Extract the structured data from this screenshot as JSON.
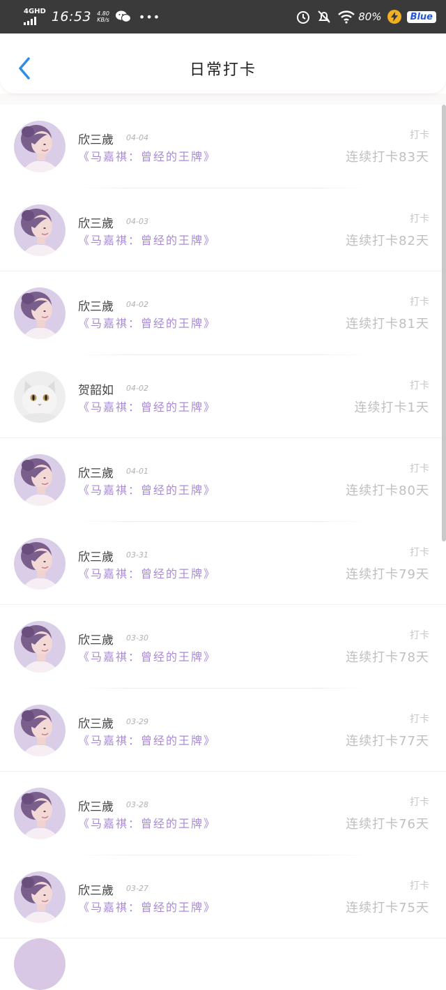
{
  "status_bar": {
    "network": "4GHD",
    "time": "16:53",
    "speed_value": "4.80",
    "speed_unit": "KB/s",
    "battery": "80%",
    "brand": "Blue"
  },
  "header": {
    "title": "日常打卡"
  },
  "colors": {
    "accent_blue": "#2f8de4",
    "content_purple": "#a98ad8",
    "muted_gray": "#bfbfbf"
  },
  "checkins": [
    {
      "user": "欣三歲",
      "date": "04-04",
      "content": "《马嘉祺：曾经的王牌》",
      "tag": "打卡",
      "streak": "连续打卡83天",
      "avatar": "girl-photo"
    },
    {
      "user": "欣三歲",
      "date": "04-03",
      "content": "《马嘉祺：曾经的王牌》",
      "tag": "打卡",
      "streak": "连续打卡82天",
      "avatar": "girl-photo"
    },
    {
      "user": "欣三歲",
      "date": "04-02",
      "content": "《马嘉祺：曾经的王牌》",
      "tag": "打卡",
      "streak": "连续打卡81天",
      "avatar": "girl-photo"
    },
    {
      "user": "贺韶如",
      "date": "04-02",
      "content": "《马嘉祺：曾经的王牌》",
      "tag": "打卡",
      "streak": "连续打卡1天",
      "avatar": "cat-photo"
    },
    {
      "user": "欣三歲",
      "date": "04-01",
      "content": "《马嘉祺：曾经的王牌》",
      "tag": "打卡",
      "streak": "连续打卡80天",
      "avatar": "girl-photo"
    },
    {
      "user": "欣三歲",
      "date": "03-31",
      "content": "《马嘉祺：曾经的王牌》",
      "tag": "打卡",
      "streak": "连续打卡79天",
      "avatar": "girl-photo"
    },
    {
      "user": "欣三歲",
      "date": "03-30",
      "content": "《马嘉祺：曾经的王牌》",
      "tag": "打卡",
      "streak": "连续打卡78天",
      "avatar": "girl-photo"
    },
    {
      "user": "欣三歲",
      "date": "03-29",
      "content": "《马嘉祺：曾经的王牌》",
      "tag": "打卡",
      "streak": "连续打卡77天",
      "avatar": "girl-photo"
    },
    {
      "user": "欣三歲",
      "date": "03-28",
      "content": "《马嘉祺：曾经的王牌》",
      "tag": "打卡",
      "streak": "连续打卡76天",
      "avatar": "girl-photo"
    },
    {
      "user": "欣三歲",
      "date": "03-27",
      "content": "《马嘉祺：曾经的王牌》",
      "tag": "打卡",
      "streak": "连续打卡75天",
      "avatar": "girl-photo"
    }
  ]
}
